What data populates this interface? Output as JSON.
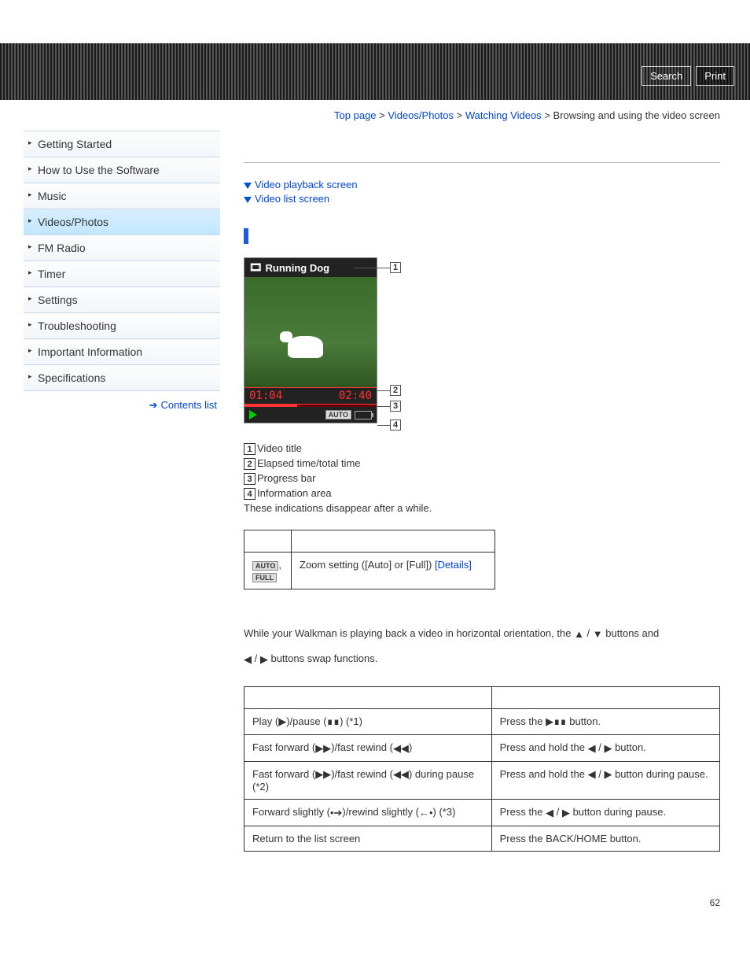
{
  "header": {
    "search": "Search",
    "print": "Print"
  },
  "breadcrumb": {
    "top": "Top page",
    "cat": "Videos/Photos",
    "sub": "Watching Videos",
    "current": "Browsing and using the video screen"
  },
  "sidebar": {
    "items": [
      "Getting Started",
      "How to Use the Software",
      "Music",
      "Videos/Photos",
      "FM Radio",
      "Timer",
      "Settings",
      "Troubleshooting",
      "Important Information",
      "Specifications"
    ],
    "contents_list": "Contents list"
  },
  "anchors": {
    "a1": "Video playback screen",
    "a2": "Video list screen"
  },
  "device": {
    "title": "Running Dog",
    "elapsed": "01:04",
    "total": "02:40",
    "auto": "AUTO"
  },
  "legend": {
    "l1": "Video title",
    "l2": "Elapsed time/total time",
    "l3": "Progress bar",
    "l4": "Information area",
    "note": "These indications disappear after a while."
  },
  "zoom_table": {
    "badge1": "AUTO",
    "badge2": "FULL",
    "text": "Zoom setting ([Auto] or [Full]) ",
    "details": "[Details]"
  },
  "orientation": {
    "p1a": "While your Walkman is playing back a video in horizontal orientation, the ",
    "p1b": " buttons and",
    "p2a": " buttons swap functions."
  },
  "ops": {
    "r1a": "Play (",
    "r1b": ")/pause (",
    "r1c": ") (*1)",
    "r1d": "Press the ",
    "r1e": " button.",
    "r2a": "Fast forward (",
    "r2b": ")/fast rewind (",
    "r2c": ")",
    "r2d": "Press and hold the ",
    "r2e": " button.",
    "r3a": "Fast forward (",
    "r3b": ")/fast rewind (",
    "r3c": ") during pause (*2)",
    "r3d": "Press and hold the ",
    "r3e": " button during pause.",
    "r4a": "Forward slightly (",
    "r4b": ")/rewind slightly (",
    "r4c": ") (*3)",
    "r4d": "Press the ",
    "r4e": " button during pause.",
    "r5a": "Return to the list screen",
    "r5b": "Press the BACK/HOME button."
  },
  "page": "62"
}
